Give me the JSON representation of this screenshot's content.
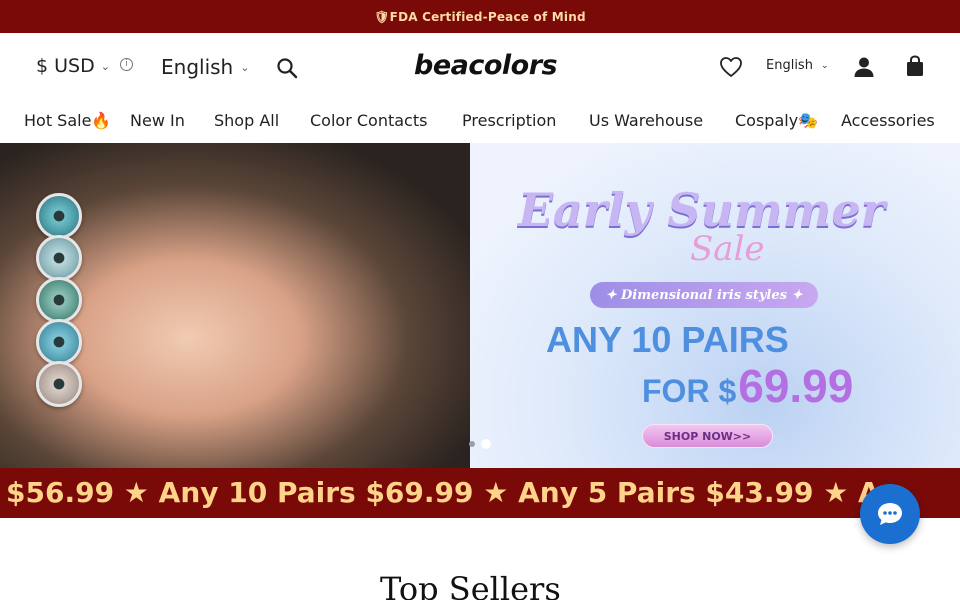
{
  "announcement": {
    "text": "🛡FDA Certified-Peace of Mind"
  },
  "header": {
    "currency": "$ USD",
    "language_left": "English",
    "logo": "beacolors",
    "language_right": "English"
  },
  "nav": {
    "items": [
      {
        "label": "Hot Sale🔥"
      },
      {
        "label": "New In"
      },
      {
        "label": "Shop All"
      },
      {
        "label": "Color Contacts"
      },
      {
        "label": "Prescription"
      },
      {
        "label": "Us Warehouse"
      },
      {
        "label": "Cospaly🎭"
      },
      {
        "label": "Accessories"
      }
    ]
  },
  "banner": {
    "title": "Early Summer",
    "subtitle": "Sale",
    "tagline": "✦ Dimensional iris styles ✦",
    "line1": "ANY 10 PAIRS",
    "line2_prefix": "FOR $",
    "line2_price": "69.99",
    "cta": "SHOP NOW>>",
    "slides": {
      "count": 2,
      "active": 2
    }
  },
  "ticker": {
    "text": "$56.99 ★ Any 10 Pairs $69.99 ★ Any 5 Pairs $43.99 ★ An"
  },
  "section": {
    "title": "Top Sellers"
  },
  "colors": {
    "announcement_bg": "#7a0a08",
    "announcement_text": "#ffd9a6",
    "ticker_text": "#ffd38a",
    "chat_button": "#1a6fd0",
    "promo_blue": "#4f8fe0",
    "promo_purple": "#b46fe2"
  },
  "icons": [
    "info-icon",
    "search-icon",
    "heart-icon",
    "user-icon",
    "bag-icon",
    "chat-icon",
    "chevron-down-icon"
  ]
}
